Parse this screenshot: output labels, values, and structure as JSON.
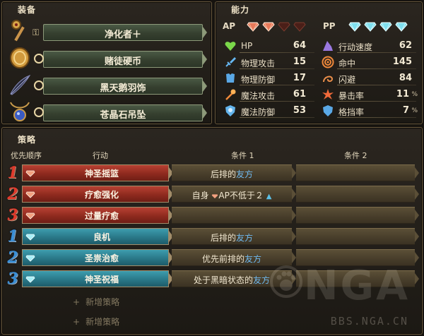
{
  "equipment": {
    "title": "装备",
    "items": [
      {
        "name": "净化者＋",
        "icon": "key-staff-icon",
        "slot": "key-slot-icon"
      },
      {
        "name": "赌徒硬币",
        "icon": "gold-coin-icon",
        "slot": "ring-slot-icon"
      },
      {
        "name": "黑天鹅羽饰",
        "icon": "black-feather-icon",
        "slot": "ring-slot-icon"
      },
      {
        "name": "苍晶石吊坠",
        "icon": "blue-pendant-icon",
        "slot": "ring-slot-icon"
      }
    ]
  },
  "ability": {
    "title": "能力",
    "ap_label": "AP",
    "ap_filled": 2,
    "ap_total": 4,
    "pp_label": "PP",
    "pp_filled": 4,
    "pp_total": 4,
    "stats": [
      {
        "label": "HP",
        "value": "64",
        "unit": "",
        "icon": "heart-icon"
      },
      {
        "label": "物理攻击",
        "value": "15",
        "unit": "",
        "icon": "sword-icon"
      },
      {
        "label": "物理防御",
        "value": "17",
        "unit": "",
        "icon": "armor-icon"
      },
      {
        "label": "魔法攻击",
        "value": "61",
        "unit": "",
        "icon": "magic-wand-icon"
      },
      {
        "label": "魔法防御",
        "value": "53",
        "unit": "",
        "icon": "magic-shield-icon"
      },
      {
        "label": "行动速度",
        "value": "62",
        "unit": "",
        "icon": "wizard-hat-icon"
      },
      {
        "label": "命中",
        "value": "145",
        "unit": "",
        "icon": "target-icon"
      },
      {
        "label": "闪避",
        "value": "84",
        "unit": "",
        "icon": "dodge-swirl-icon"
      },
      {
        "label": "暴击率",
        "value": "11",
        "unit": "%",
        "icon": "critical-burst-icon"
      },
      {
        "label": "格挡率",
        "value": "7",
        "unit": "%",
        "icon": "shield-icon"
      }
    ],
    "colors": {
      "ap_gem": "#e6795a",
      "pp_gem": "#7fe0ef"
    }
  },
  "strategy": {
    "title": "策略",
    "headers": {
      "priority": "优先顺序",
      "action": "行动",
      "cond1": "条件 1",
      "cond2": "条件 2"
    },
    "rows": [
      {
        "rank": "1",
        "type": "red",
        "action": "神圣摇篮",
        "cond1_parts": [
          "后排的",
          "友方",
          "",
          ""
        ],
        "cond2": ""
      },
      {
        "rank": "2",
        "type": "red",
        "action": "疗愈强化",
        "cond1_parts": [
          "自身",
          "",
          "AP不低于２",
          "▲"
        ],
        "cond2": ""
      },
      {
        "rank": "3",
        "type": "red",
        "action": "过量疗愈",
        "cond1_parts": [
          "",
          "",
          "",
          ""
        ],
        "cond2": ""
      },
      {
        "rank": "1",
        "type": "blue",
        "action": "良机",
        "cond1_parts": [
          "后排的",
          "友方",
          "",
          ""
        ],
        "cond2": ""
      },
      {
        "rank": "2",
        "type": "blue",
        "action": "圣祟治愈",
        "cond1_parts": [
          "优先前排的",
          "友方",
          "",
          ""
        ],
        "cond2": ""
      },
      {
        "rank": "3",
        "type": "blue",
        "action": "神圣祝福",
        "cond1_parts": [
          "处于黑暗状态的",
          "友方",
          "",
          ""
        ],
        "cond2": ""
      }
    ],
    "add_label": "新增策略",
    "add_count": 2
  },
  "watermark": {
    "text": "NGA",
    "url": "BBS.NGA.CN"
  }
}
